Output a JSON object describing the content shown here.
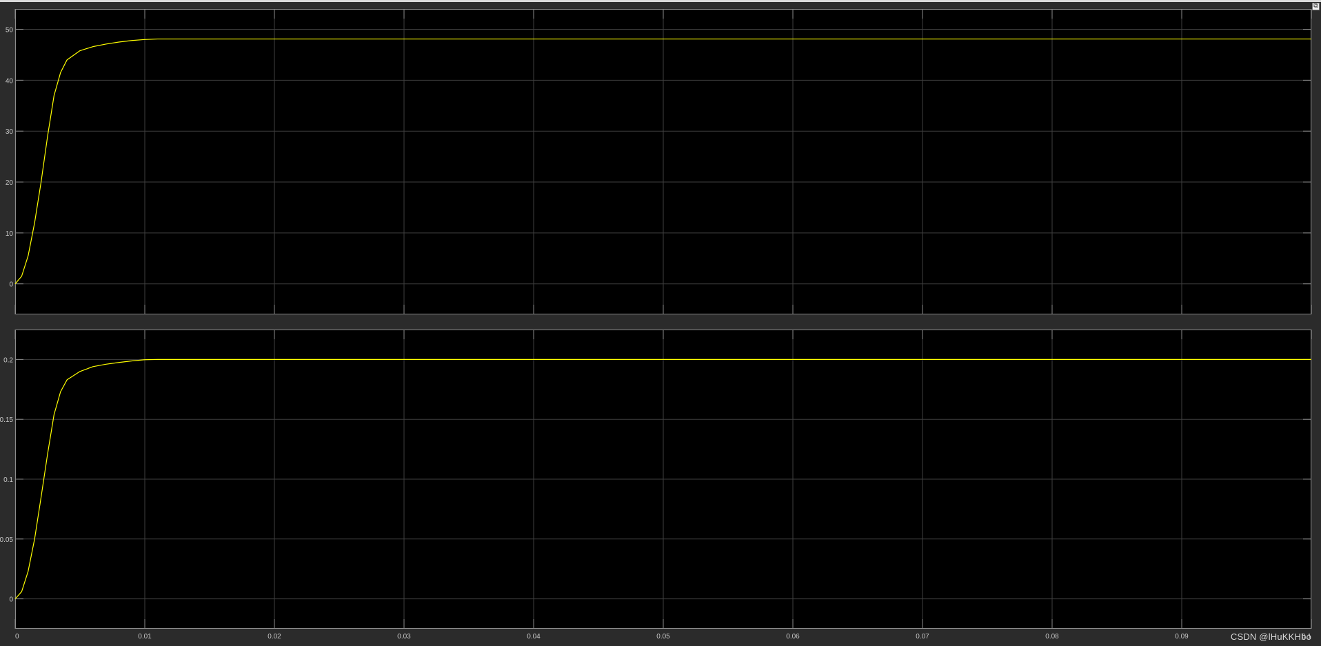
{
  "window": {
    "corner_button_glyph": "⧉"
  },
  "watermark": "CSDN @lHuKKHbo",
  "colors": {
    "background": "#2b2b2b",
    "plot_background": "#000000",
    "grid": "#3f3f3f",
    "axis_frame": "#8c8c8c",
    "tick_label": "#c8c8c8",
    "signal": "#ffff00"
  },
  "chart_data": [
    {
      "type": "line",
      "title": "",
      "xlabel": "",
      "ylabel": "",
      "grid": true,
      "legend": "none",
      "xlim": [
        0,
        0.1
      ],
      "ylim": [
        -6,
        54
      ],
      "xticks": [
        0,
        0.01,
        0.02,
        0.03,
        0.04,
        0.05,
        0.06,
        0.07,
        0.08,
        0.09,
        0.1
      ],
      "xtick_labels": [],
      "yticks": [
        0,
        10,
        20,
        30,
        40,
        50
      ],
      "ytick_labels": [
        "0",
        "10",
        "20",
        "30",
        "40",
        "50"
      ],
      "series": [
        {
          "color": "#ffff00",
          "x": [
            0,
            0.0005,
            0.001,
            0.0015,
            0.002,
            0.0025,
            0.003,
            0.0035,
            0.004,
            0.005,
            0.006,
            0.007,
            0.008,
            0.009,
            0.01,
            0.011,
            0.02,
            0.03,
            0.04,
            0.05,
            0.06,
            0.07,
            0.08,
            0.09,
            0.1
          ],
          "y": [
            0,
            1.5,
            5.5,
            12,
            20,
            29,
            37,
            41.5,
            44,
            45.8,
            46.6,
            47.1,
            47.5,
            47.8,
            48,
            48.1,
            48.1,
            48.1,
            48.1,
            48.1,
            48.1,
            48.1,
            48.1,
            48.1,
            48.1
          ]
        }
      ]
    },
    {
      "type": "line",
      "title": "",
      "xlabel": "",
      "ylabel": "",
      "grid": true,
      "legend": "none",
      "xlim": [
        0,
        0.1
      ],
      "ylim": [
        -0.025,
        0.225
      ],
      "xticks": [
        0,
        0.01,
        0.02,
        0.03,
        0.04,
        0.05,
        0.06,
        0.07,
        0.08,
        0.09,
        0.1
      ],
      "xtick_labels": [
        "0",
        "0.01",
        "0.02",
        "0.03",
        "0.04",
        "0.05",
        "0.06",
        "0.07",
        "0.08",
        "0.09",
        "0.1"
      ],
      "yticks": [
        0,
        0.05,
        0.1,
        0.15,
        0.2
      ],
      "ytick_labels": [
        "0",
        "0.05",
        "0.1",
        "0.15",
        "0.2"
      ],
      "series": [
        {
          "color": "#ffff00",
          "x": [
            0,
            0.0005,
            0.001,
            0.0015,
            0.002,
            0.0025,
            0.003,
            0.0035,
            0.004,
            0.005,
            0.006,
            0.007,
            0.008,
            0.009,
            0.01,
            0.011,
            0.02,
            0.03,
            0.04,
            0.05,
            0.06,
            0.07,
            0.08,
            0.09,
            0.1
          ],
          "y": [
            0,
            0.006,
            0.023,
            0.05,
            0.085,
            0.121,
            0.154,
            0.173,
            0.183,
            0.19,
            0.194,
            0.196,
            0.1975,
            0.1988,
            0.1998,
            0.2,
            0.2,
            0.2,
            0.2,
            0.2,
            0.2,
            0.2,
            0.2,
            0.2,
            0.2
          ]
        }
      ]
    }
  ]
}
